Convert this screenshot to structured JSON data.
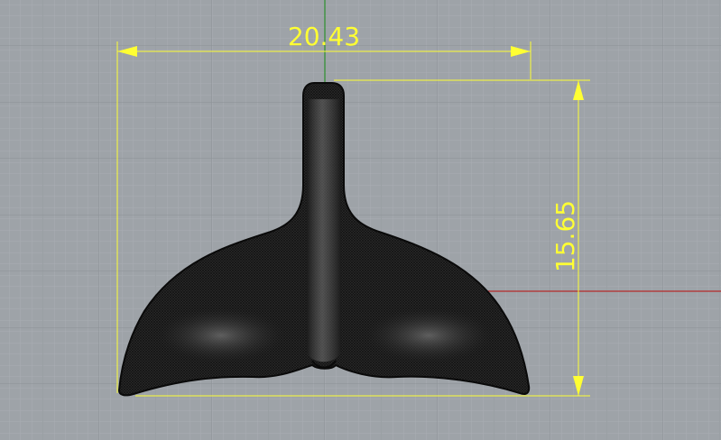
{
  "viewport": {
    "background": "#9ea3a8",
    "grid": {
      "minor_color": "#a9aeb3",
      "major_color": "#8c9196"
    },
    "axes": {
      "x_axis_color": "#b52a2a",
      "y_axis_color": "#2c8f2c"
    }
  },
  "object": {
    "kind": "whale tail mesh",
    "fill": "#2b2b2b",
    "wire": "#0d0d0d"
  },
  "dimensions": {
    "color": "#ffff33",
    "width": {
      "value": "20.43"
    },
    "height": {
      "value": "15.65"
    }
  }
}
